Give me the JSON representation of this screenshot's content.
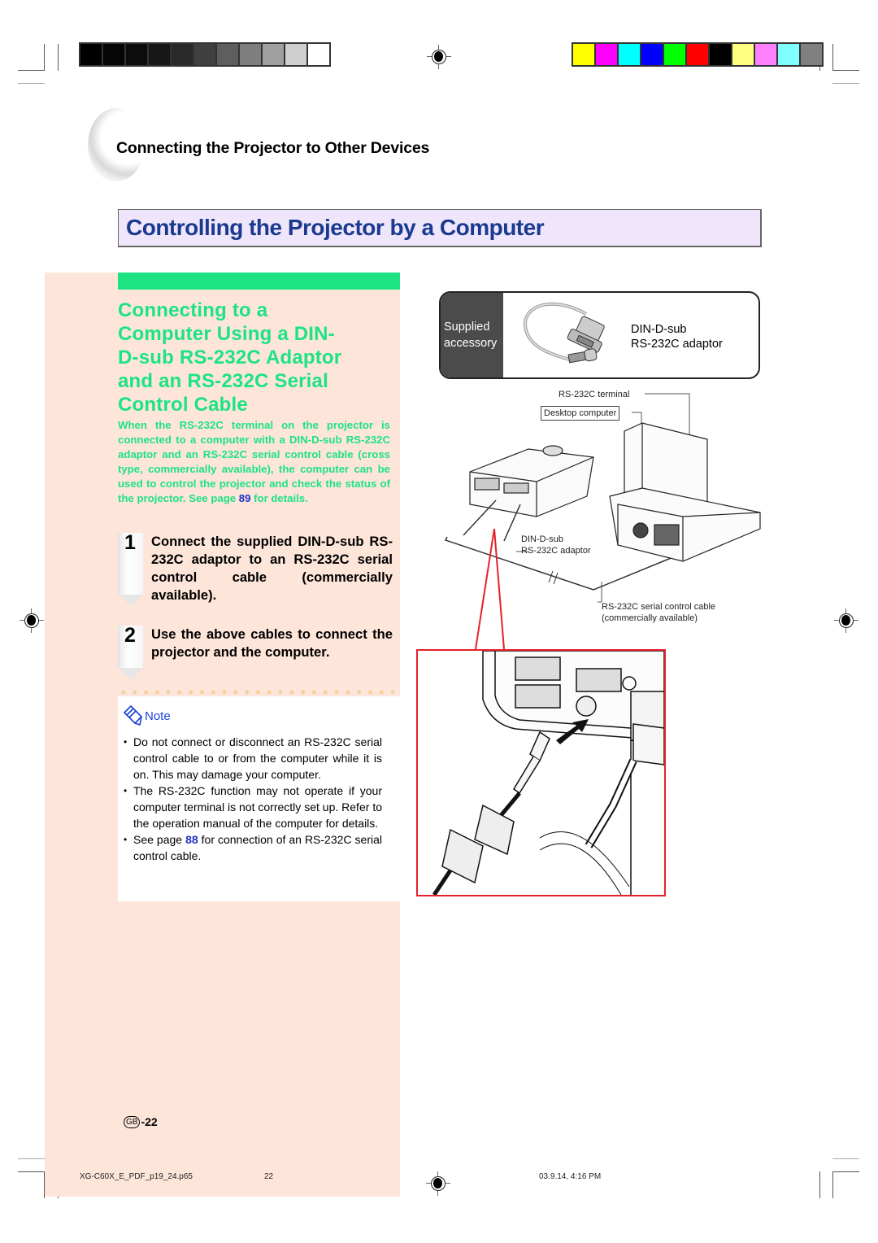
{
  "print_marks": {
    "gray_swatches": [
      "#000000",
      "#050505",
      "#0c0c0c",
      "#171717",
      "#2a2a2a",
      "#404040",
      "#5e5e5e",
      "#7e7e7e",
      "#a0a0a0",
      "#cfcfcf",
      "#ffffff"
    ],
    "color_swatches": [
      "#ffff00",
      "#ff00ff",
      "#00ffff",
      "#0000ff",
      "#00ff00",
      "#ff0000",
      "#000000",
      "#ffff80",
      "#ff80ff",
      "#80ffff",
      "#808080"
    ]
  },
  "section": {
    "title": "Connecting the Projector to Other Devices"
  },
  "page_title": "Controlling the Projector by a Computer",
  "subsection": {
    "heading": "Connecting to a Computer Using a DIN-D-sub RS-232C Adaptor and an RS-232C Serial Control Cable",
    "heading_lines": [
      "Connecting to a",
      "Computer Using a DIN-",
      "D-sub RS-232C Adaptor",
      "and an RS-232C Serial",
      "Control Cable"
    ],
    "intro_before_link": "When the RS-232C terminal on the projector is connected to a computer with a DIN-D-sub RS-232C adaptor and an RS-232C serial control cable (cross type, commercially available), the computer can be used to control the projector and check the status of the projector. See page ",
    "intro_link": "89",
    "intro_after_link": " for details."
  },
  "steps": [
    {
      "number": "1",
      "text": "Connect the supplied DIN-D-sub RS-232C adaptor to an RS-232C serial control cable (commercially available)."
    },
    {
      "number": "2",
      "text": "Use the above cables to connect the projector and the computer."
    }
  ],
  "note": {
    "label": "Note",
    "items": [
      {
        "text": "Do not connect or disconnect an RS-232C serial control cable to or from the computer while it is on. This may damage your computer."
      },
      {
        "text": "The RS-232C function may not operate if your computer terminal is not correctly set up. Refer to the operation manual of the computer for details."
      },
      {
        "text_before": "See page ",
        "link": "88",
        "text_after": " for connection of an RS-232C serial control cable."
      }
    ]
  },
  "diagram": {
    "accessory_side_line1": "Supplied",
    "accessory_side_line2": "accessory",
    "accessory_name_line1": "DIN-D-sub",
    "accessory_name_line2": "RS-232C adaptor",
    "label_terminal": "RS-232C terminal",
    "label_desktop": "Desktop computer",
    "label_adaptor_line1": "DIN-D-sub",
    "label_adaptor_line2": "RS-232C adaptor",
    "label_cable_line1": "RS-232C serial control cable",
    "label_cable_line2": "(commercially available)",
    "highlight_color": "#e81f2a"
  },
  "footer": {
    "region_badge": "GB",
    "page_number": "-22",
    "file_name": "XG-C60X_E_PDF_p19_24.p65",
    "file_page": "22",
    "timestamp": "03.9.14, 4:16 PM"
  },
  "colors": {
    "title_blue": "#1a3a8f",
    "title_bg": "#f0e6fb",
    "accent_green": "#1de383",
    "peach_bg": "#fde5da",
    "link_blue": "#1a32c8"
  }
}
